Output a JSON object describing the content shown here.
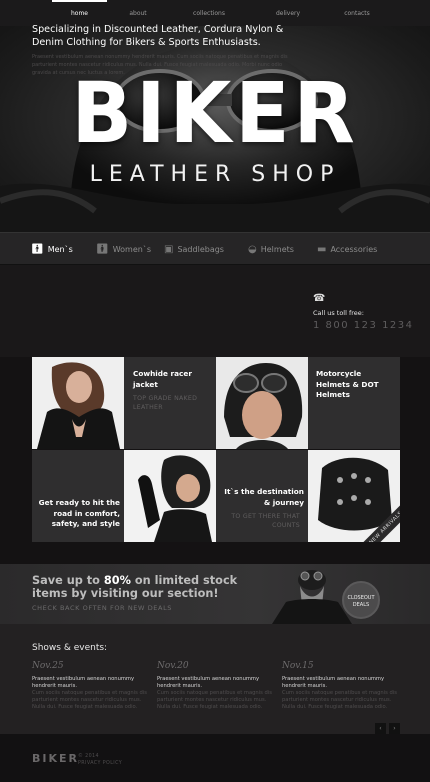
{
  "nav": {
    "items": [
      "home",
      "about",
      "collections",
      "delivery",
      "contacts"
    ]
  },
  "hero": {
    "title": "BIKER",
    "subtitle": "LEATHER SHOP"
  },
  "categories": [
    {
      "label": "Men`s",
      "icon": "man-icon"
    },
    {
      "label": "Women`s",
      "icon": "woman-icon"
    },
    {
      "label": "Saddlebags",
      "icon": "saddlebag-icon"
    },
    {
      "label": "Helmets",
      "icon": "helmet-icon"
    },
    {
      "label": "Accessories",
      "icon": "sunglasses-icon"
    }
  ],
  "intro": {
    "headline": "Specializing in Discounted Leather, Cordura Nylon & Denim Clothing for Bikers & Sports Enthusiasts.",
    "body": "Praesent vestibulum aenean nonummy hendrerit mauris. Cum sociis natoque penatibus et magnis dis parturient montes nascetur ridiculus mus. Nulla dui. Fusce feugiat malesuada odio. Morbi nunc odio gravida at cursus nec luctus a lorem."
  },
  "contact": {
    "label": "Call us toll free:",
    "number": "1 800 123 1234"
  },
  "tiles": {
    "racer": {
      "title": "Cowhide racer jacket",
      "sub": "TOP GRADE NAKED LEATHER"
    },
    "motorcycle": {
      "title": "Motorcycle Helmets & DOT Helmets"
    },
    "road": {
      "title": "Get ready to hit the road in comfort, safety, and style"
    },
    "journey": {
      "title": "It`s the destination & journey",
      "sub": "TO GET THERE THAT COUNTS"
    },
    "ribbon": "NEW ARRIVALS"
  },
  "promo": {
    "line_prefix": "Save up to ",
    "percent": "80%",
    "line_suffix": " on limited stock items by visiting our section!",
    "sub": "CHECK BACK OFTEN FOR NEW DEALS",
    "badge": "CLOSEOUT DEALS"
  },
  "events": {
    "heading": "Shows & events:",
    "items": [
      {
        "date": "Nov.25",
        "title": "Praesent vestibulum aenean nonummy hendrerit mauris.",
        "body": "Cum sociis natoque penatibus et magnis dis parturient montes nascetur ridiculus mus. Nulla dui. Fusce feugiat malesuada odio."
      },
      {
        "date": "Nov.20",
        "title": "Praesent vestibulum aenean nonummy hendrerit mauris.",
        "body": "Cum sociis natoque penatibus et magnis dis parturient montes nascetur ridiculus mus. Nulla dui. Fusce feugiat malesuada odio."
      },
      {
        "date": "Nov.15",
        "title": "Praesent vestibulum aenean nonummy hendrerit mauris.",
        "body": "Cum sociis natoque penatibus et magnis dis parturient montes nascetur ridiculus mus. Nulla dui. Fusce feugiat malesuada odio."
      }
    ],
    "prev": "‹",
    "next": "›"
  },
  "footer": {
    "logo": "BIKER",
    "copyright": "© 2014",
    "privacy": "PRIVACY POLICY"
  }
}
